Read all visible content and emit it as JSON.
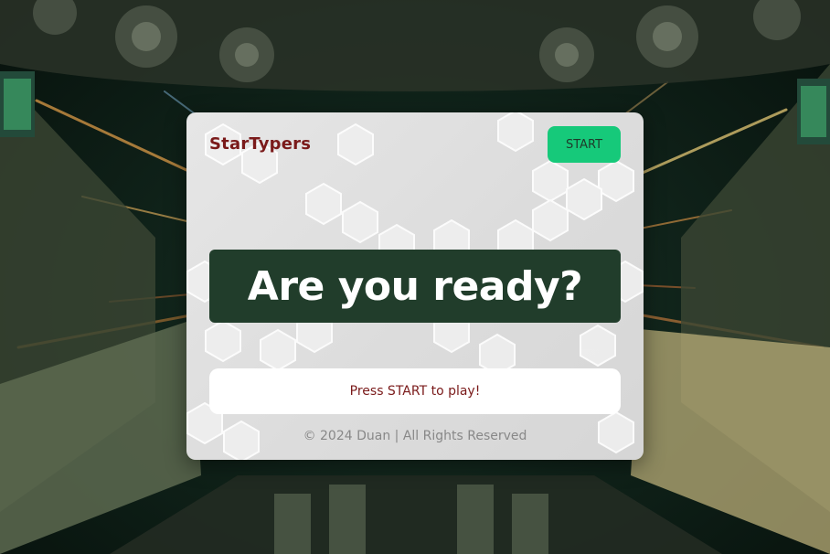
{
  "header": {
    "brand": "StarTypers",
    "start_label": "START"
  },
  "main": {
    "headline": "Are you ready?",
    "prompt": "Press START to play!"
  },
  "footer": {
    "text": "© 2024 Duan | All Rights Reserved"
  },
  "colors": {
    "brand": "#7a1a1a",
    "start_button": "#16c97a",
    "banner": "#213d2b",
    "card": "#e0e0e0"
  }
}
